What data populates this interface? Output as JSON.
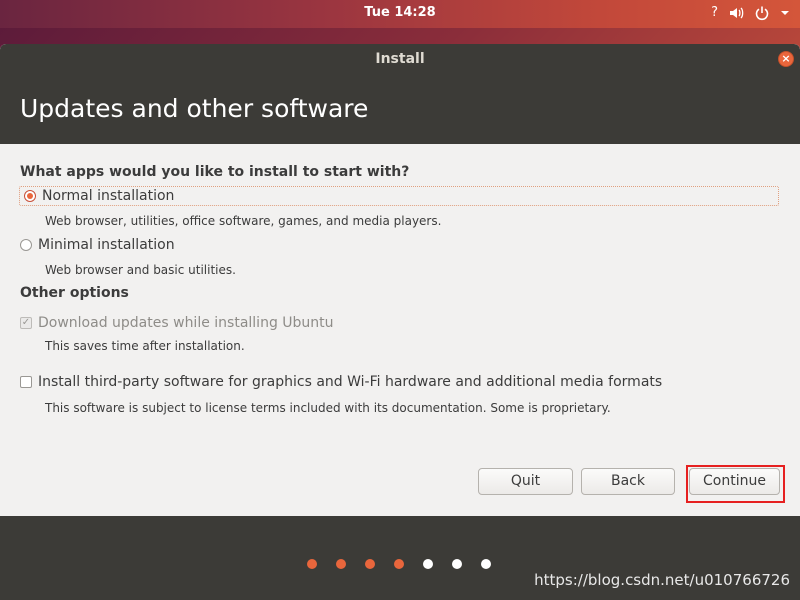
{
  "topbar": {
    "clock": "Tue 14:28",
    "accessibility_glyph": "?",
    "icons": [
      "accessibility-icon",
      "volume-icon",
      "power-icon",
      "chevron-down-icon"
    ]
  },
  "window": {
    "title": "Install",
    "close_glyph": "×"
  },
  "page": {
    "title": "Updates and other software"
  },
  "apps_section": {
    "title": "What apps would you like to install to start with?",
    "options": [
      {
        "label": "Normal installation",
        "description": "Web browser, utilities, office software, games, and media players.",
        "checked": true
      },
      {
        "label": "Minimal installation",
        "description": "Web browser and basic utilities.",
        "checked": false
      }
    ]
  },
  "other_section": {
    "title": "Other options",
    "options": [
      {
        "label": "Download updates while installing Ubuntu",
        "description": "This saves time after installation.",
        "checked": true,
        "disabled": true,
        "check_glyph": "✓"
      },
      {
        "label": "Install third-party software for graphics and Wi-Fi hardware and additional media formats",
        "description": "This software is subject to license terms included with its documentation. Some is proprietary.",
        "checked": false,
        "disabled": false
      }
    ]
  },
  "buttons": {
    "quit": "Quit",
    "back": "Back",
    "continue": "Continue"
  },
  "progress": {
    "total_steps": 7,
    "completed_steps": 4,
    "done_color": "#e9663c",
    "pending_color": "#ffffff"
  },
  "watermark": "https://blog.csdn.net/u010766726",
  "colors": {
    "accent": "#e9663c",
    "highlight": "#e62020",
    "header_bg": "#3c3b37"
  }
}
